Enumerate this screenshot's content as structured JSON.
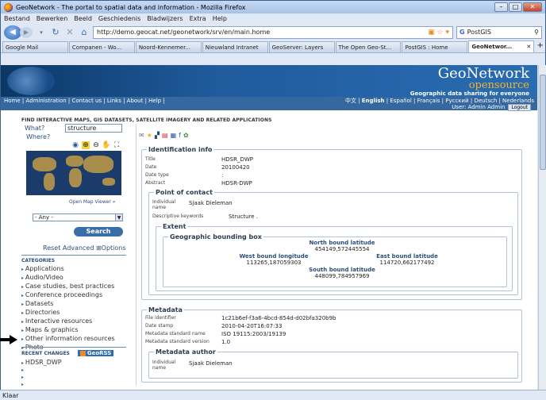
{
  "window": {
    "title": "GeoNetwork - The portal to spatial data and information - Mozilla Firefox"
  },
  "menu": [
    "Bestand",
    "Bewerken",
    "Beeld",
    "Geschiedenis",
    "Bladwijzers",
    "Extra",
    "Help"
  ],
  "nav": {
    "url": "http://demo.geocat.net/geonetwork/srv/en/main.home",
    "search": "PostGIS"
  },
  "tabs": [
    "Google Mail",
    "Companen - Wo...",
    "Noord-Kennemer...",
    "Nieuwland Intranet",
    "GeoServer: Layers",
    "The Open Geo-St...",
    "PostGIS : Home",
    "GeoNetwor..."
  ],
  "banner": {
    "name": "GeoNetwork",
    "sub": "opensource",
    "tagline": "Geographic data sharing for everyone"
  },
  "topnav": {
    "links": "Home | Administration | Contact us | Links | About | Help |",
    "langs_pre": "中文 | ",
    "lang_active": "English",
    "langs_post": " | Español | Français | Русский | Deutsch | Nederlands",
    "user": "User: Admin Admin",
    "logout": "Logout"
  },
  "find_header": "FIND INTERACTIVE MAPS, GIS DATASETS, SATELLITE IMAGERY AND RELATED APPLICATIONS",
  "left": {
    "what_label": "What?",
    "what_value": "structure",
    "where_label": "Where?",
    "open_map": "Open Map Viewer »",
    "any": "- Any -",
    "search": "Search",
    "reset": "Reset  Advanced  ⊞Options",
    "categories_header": "CATEGORIES",
    "categories": [
      "Applications",
      "Audio/Video",
      "Case studies, best practices",
      "Conference proceedings",
      "Datasets",
      "Directories",
      "Interactive resources",
      "Maps & graphics",
      "Other information resources",
      "Photo"
    ],
    "recent_header": "RECENT CHANGES",
    "georss": "GeoRSS",
    "recent": [
      "HDSR_DWP",
      "",
      "",
      "",
      "",
      ""
    ]
  },
  "ident": {
    "legend": "Identification info",
    "title_l": "Title",
    "title_v": "HDSR_DWP",
    "date_l": "Date",
    "date_v": "20100420",
    "type_l": "Date type",
    "type_v": ":",
    "abs_l": "Abstract",
    "abs_v": "HDSR-DWP",
    "poc_legend": "Point of contact",
    "ind_l": "Individual name",
    "ind_v": "Sjaak Dieleman",
    "kw_l": "Descriptive keywords",
    "kw_v": "Structure .",
    "extent_legend": "Extent",
    "bbox_legend": "Geographic bounding box",
    "north_l": "North bound latitude",
    "north_v": "454149,572445554",
    "west_l": "West bound longitude",
    "west_v": "113265,187059303",
    "east_l": "East bound latitude",
    "east_v": "114720,662177492",
    "south_l": "South bound latitude",
    "south_v": "448099,784957969"
  },
  "meta": {
    "legend": "Metadata",
    "fid_l": "File identifier",
    "fid_v": "1c21b6ef-f3a6-4bcd-854d-d02bfa320b9b",
    "ds_l": "Date stamp",
    "ds_v": "2010-04-20T16:07:33",
    "msn_l": "Metadata standard name",
    "msn_v": "ISO 19115:2003/19139",
    "msv_l": "Metadata standard version",
    "msv_v": "1.0",
    "author_legend": "Metadata author",
    "ind_l": "Individual name",
    "ind_v": "Sjaak Dieleman"
  },
  "status": "Klaar"
}
